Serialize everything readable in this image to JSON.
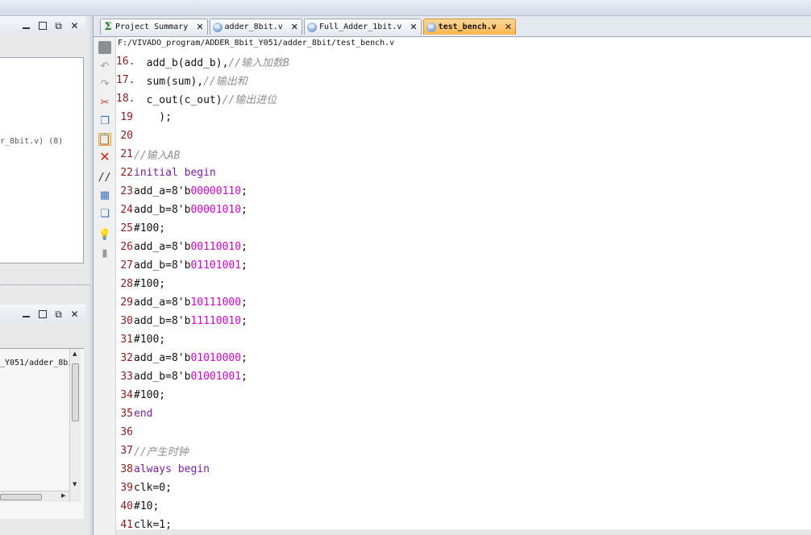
{
  "left_panel": {
    "top_text": "r_8bit.v) (8)",
    "bottom_text": "_Y051/adder_8bi"
  },
  "tabs": [
    {
      "label": "Project Summary",
      "icon": "sigma-icon"
    },
    {
      "label": "adder_8bit.v",
      "icon": "verilog-file-icon"
    },
    {
      "label": "Full_Adder_1bit.v",
      "icon": "verilog-file-icon"
    },
    {
      "label": "test_bench.v",
      "icon": "verilog-file-icon",
      "active": true
    }
  ],
  "file_path": "F:/VIVADO_program/ADDER_8bit_Y051/adder_8bit/test_bench.v",
  "toolbar_icons": [
    "save-icon",
    "undo-icon",
    "redo-icon",
    "cut-icon",
    "copy-icon",
    "paste-icon",
    "delete-icon",
    "comment-icon",
    "select-block-icon",
    "insert-template-icon",
    "bulb-icon",
    "trash-icon"
  ],
  "code_lines": [
    {
      "n": "16",
      "segs": [
        [
          "pl",
          "  add_b(add_b),"
        ],
        [
          "cm",
          "//输入加数B"
        ]
      ]
    },
    {
      "n": "17",
      "segs": [
        [
          "pl",
          "  sum(sum),"
        ],
        [
          "cm",
          "//输出和"
        ]
      ]
    },
    {
      "n": "18",
      "segs": [
        [
          "pl",
          "  c_out(c_out)"
        ],
        [
          "cm",
          "//输出进位"
        ]
      ]
    },
    {
      "n": "19",
      "segs": [
        [
          "pl",
          "    );"
        ]
      ]
    },
    {
      "n": "20",
      "segs": []
    },
    {
      "n": "21",
      "segs": [
        [
          "cm",
          "//输入AB"
        ]
      ]
    },
    {
      "n": "22",
      "segs": [
        [
          "kw",
          "initial begin"
        ]
      ]
    },
    {
      "n": "23",
      "segs": [
        [
          "pl",
          "add_a=8'b"
        ],
        [
          "num",
          "00000110"
        ],
        [
          "pl",
          ";"
        ]
      ]
    },
    {
      "n": "24",
      "segs": [
        [
          "pl",
          "add_b=8'b"
        ],
        [
          "num",
          "00001010"
        ],
        [
          "pl",
          ";"
        ]
      ]
    },
    {
      "n": "25",
      "segs": [
        [
          "pl",
          "#100;"
        ]
      ]
    },
    {
      "n": "26",
      "segs": [
        [
          "pl",
          "add_a=8'b"
        ],
        [
          "num",
          "00110010"
        ],
        [
          "pl",
          ";"
        ]
      ]
    },
    {
      "n": "27",
      "segs": [
        [
          "pl",
          "add_b=8'b"
        ],
        [
          "num",
          "01101001"
        ],
        [
          "pl",
          ";"
        ]
      ]
    },
    {
      "n": "28",
      "segs": [
        [
          "pl",
          "#100;"
        ]
      ]
    },
    {
      "n": "29",
      "segs": [
        [
          "pl",
          "add_a=8'b"
        ],
        [
          "num",
          "10111000"
        ],
        [
          "pl",
          ";"
        ]
      ]
    },
    {
      "n": "30",
      "segs": [
        [
          "pl",
          "add_b=8'b"
        ],
        [
          "num",
          "11110010"
        ],
        [
          "pl",
          ";"
        ]
      ]
    },
    {
      "n": "31",
      "segs": [
        [
          "pl",
          "#100;"
        ]
      ]
    },
    {
      "n": "32",
      "segs": [
        [
          "pl",
          "add_a=8'b"
        ],
        [
          "num",
          "01010000"
        ],
        [
          "pl",
          ";"
        ]
      ]
    },
    {
      "n": "33",
      "segs": [
        [
          "pl",
          "add_b=8'b"
        ],
        [
          "num",
          "01001001"
        ],
        [
          "pl",
          ";"
        ]
      ]
    },
    {
      "n": "34",
      "segs": [
        [
          "pl",
          "#100;"
        ]
      ]
    },
    {
      "n": "35",
      "segs": [
        [
          "kw",
          "end"
        ]
      ]
    },
    {
      "n": "36",
      "segs": []
    },
    {
      "n": "37",
      "segs": [
        [
          "cm",
          "//产生时钟"
        ]
      ]
    },
    {
      "n": "38",
      "segs": [
        [
          "kw",
          "always begin"
        ]
      ]
    },
    {
      "n": "39",
      "segs": [
        [
          "pl",
          "clk=0;"
        ]
      ]
    },
    {
      "n": "40",
      "segs": [
        [
          "pl",
          "#10;"
        ]
      ]
    },
    {
      "n": "41",
      "segs": [
        [
          "pl",
          "clk=1;"
        ]
      ]
    }
  ]
}
